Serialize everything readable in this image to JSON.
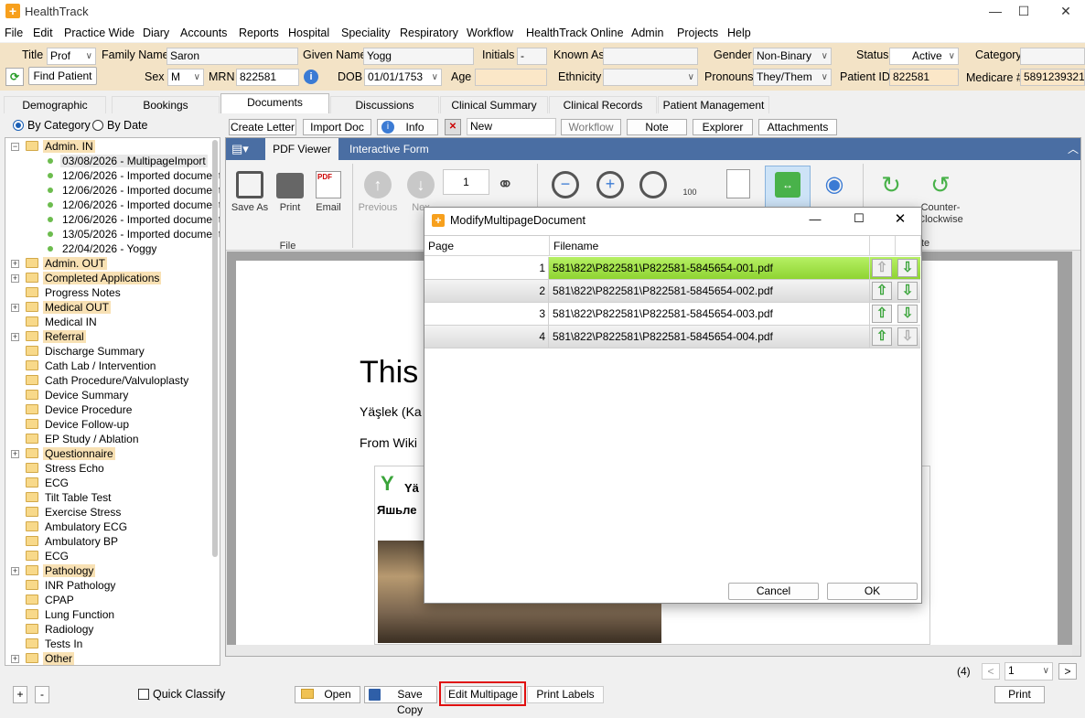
{
  "window": {
    "title": "HealthTrack",
    "app_icon": "+",
    "minimize": "—",
    "maximize": "☐",
    "close": "✕"
  },
  "menu": [
    "File",
    "Edit",
    "Practice Wide",
    "Diary",
    "Accounts",
    "Reports",
    "Hospital",
    "Speciality",
    "Respiratory",
    "Workflow",
    "HealthTrack Online",
    "Admin",
    "Projects",
    "Help"
  ],
  "patient": {
    "title_label": "Title",
    "title_value": "Prof",
    "family_label": "Family Name",
    "family_value": "Saron",
    "given_label": "Given Name",
    "given_value": "Yogg",
    "initials_label": "Initials",
    "initials_value": "-",
    "known_label": "Known As",
    "known_value": "",
    "gender_label": "Gender",
    "gender_value": "Non-Binary",
    "status_label": "Status",
    "status_value": "Active",
    "category_label": "Category",
    "category_value": "",
    "find_button": "Find Patient",
    "sex_label": "Sex",
    "sex_value": "M",
    "mrn_label": "MRN",
    "mrn_value": "822581",
    "dob_label": "DOB",
    "dob_value": "01/01/1753",
    "age_label": "Age",
    "age_value": "",
    "ethnicity_label": "Ethnicity",
    "ethnicity_value": "",
    "pronouns_label": "Pronouns",
    "pronouns_value": "They/Them",
    "patientid_label": "Patient ID",
    "patientid_value": "822581",
    "medicare_label": "Medicare #",
    "medicare_value": "5891239321"
  },
  "tabs": [
    "Demographic",
    "Bookings",
    "Documents",
    "Discussions",
    "Clinical Summary",
    "Clinical Records",
    "Patient Management"
  ],
  "view_mode": {
    "by_category": "By Category",
    "by_date": "By Date"
  },
  "doc_toolbar": {
    "create": "Create Letter",
    "import": "Import Doc",
    "info": "Info",
    "new_value": "New",
    "workflow": "Workflow",
    "note": "Note",
    "explorer": "Explorer",
    "attachments": "Attachments"
  },
  "tree": {
    "admin_in": "Admin. IN",
    "admin_in_docs": [
      "03/08/2026 - MultipageImport",
      "12/06/2026 - Imported document",
      "12/06/2026 - Imported document",
      "12/06/2026 - Imported document",
      "12/06/2026 - Imported document",
      "13/05/2026 - Imported document",
      "22/04/2026 - Yoggy"
    ],
    "folders": [
      "Admin. OUT",
      "Completed Applications",
      "Progress Notes",
      "Medical OUT",
      "Medical IN",
      "Referral",
      "Discharge Summary",
      "Cath Lab / Intervention",
      "Cath Procedure/Valvuloplasty",
      "Device Summary",
      "Device Procedure",
      "Device Follow-up",
      "EP Study / Ablation",
      "Questionnaire",
      "Stress Echo",
      "ECG",
      "Tilt Table Test",
      "Exercise Stress",
      "Ambulatory ECG",
      "Ambulatory BP",
      "ECG",
      "Pathology",
      "INR Pathology",
      "CPAP",
      "Lung Function",
      "Radiology",
      "Tests In",
      "Other"
    ]
  },
  "viewer": {
    "tab_pdf": "PDF Viewer",
    "tab_form": "Interactive Form",
    "save_as": "Save As",
    "print": "Print",
    "email": "Email",
    "file_group": "File",
    "previous": "Previous",
    "next": "Nex",
    "page_num": "1",
    "of": "of 1",
    "rotate_cw": "Clock",
    "rotate_ccw": "Counter-\nClockwise",
    "rotate_group": "te",
    "zoom_pct": "100"
  },
  "document": {
    "heading": "This",
    "line1": "Yäşlek (Ka",
    "line2": "From Wiki",
    "banner1": "Yä",
    "banner2": "Яшьле"
  },
  "dialog": {
    "title": "ModifyMultipageDocument",
    "col_page": "Page",
    "col_filename": "Filename",
    "rows": [
      {
        "page": "1",
        "filename": "581\\822\\P822581\\P822581-5845654-001.pdf"
      },
      {
        "page": "2",
        "filename": "581\\822\\P822581\\P822581-5845654-002.pdf"
      },
      {
        "page": "3",
        "filename": "581\\822\\P822581\\P822581-5845654-003.pdf"
      },
      {
        "page": "4",
        "filename": "581\\822\\P822581\\P822581-5845654-004.pdf"
      }
    ],
    "up": "⇧",
    "down": "⇩",
    "cancel": "Cancel",
    "ok": "OK"
  },
  "bottom": {
    "plus": "+",
    "minus": "-",
    "quick_classify": "Quick Classify",
    "open": "Open",
    "save_copy": "Save Copy",
    "edit_multipage": "Edit Multipage",
    "print_labels": "Print Labels",
    "page_count": "(4)",
    "page_select": "1",
    "print": "Print"
  },
  "colors": {
    "patient_bg": "#f3e3c6",
    "ribbon_blue": "#4a6ea3",
    "selected_row": "#9be23a",
    "highlight_red": "#e01010"
  }
}
